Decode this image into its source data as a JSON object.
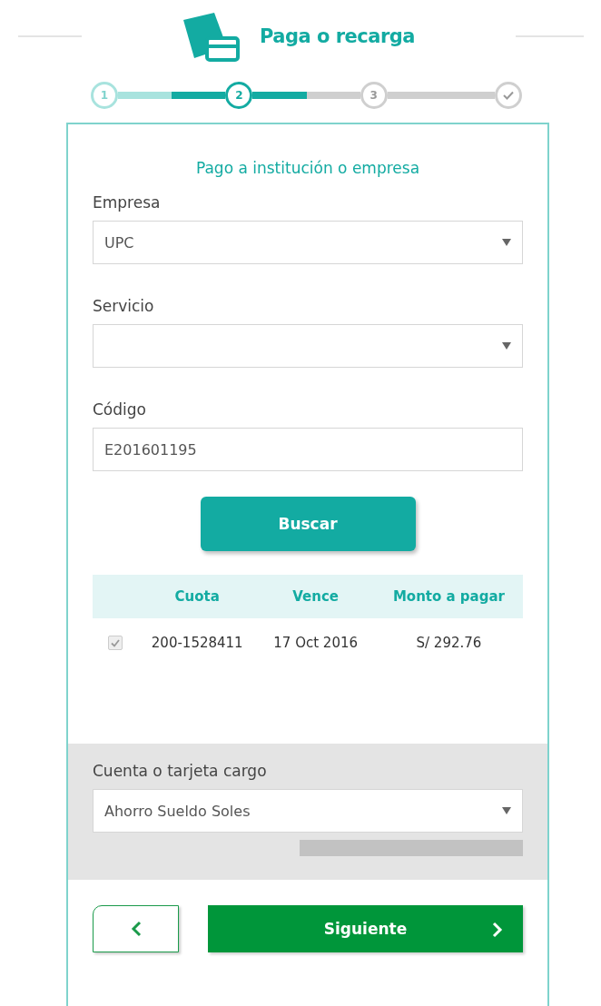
{
  "header": {
    "title": "Paga o recarga"
  },
  "steps": [
    {
      "kind": "number",
      "label": "1",
      "completed": true,
      "selected": false
    },
    {
      "kind": "number",
      "label": "2",
      "completed": false,
      "selected": true
    },
    {
      "kind": "number",
      "label": "3",
      "completed": false,
      "selected": false
    },
    {
      "kind": "check",
      "completed": false,
      "selected": false
    }
  ],
  "form": {
    "title": "Pago a institución o empresa",
    "fields": [
      {
        "kind": "select",
        "label": "Empresa",
        "value": "UPC"
      },
      {
        "kind": "select",
        "label": "Servicio"
      },
      {
        "kind": "text",
        "label": "Código",
        "value": "E201601195"
      }
    ],
    "search_button": "Buscar"
  },
  "table": {
    "columns": [
      "Cuota",
      "Vence",
      "Monto a pagar"
    ],
    "rows": [
      {
        "checked": true,
        "disabled": true,
        "cells": [
          "200-1528411",
          "17 Oct 2016",
          "S/ 292.76"
        ]
      }
    ]
  },
  "account": {
    "label": "Cuenta o tarjeta cargo",
    "value": "Ahorro Sueldo Soles"
  },
  "footer": {
    "next_button": "Siguiente"
  }
}
